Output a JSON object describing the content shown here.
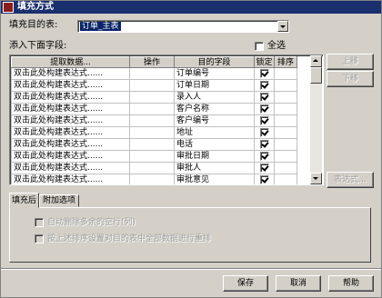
{
  "window": {
    "title": "填充方式"
  },
  "target": {
    "label": "填充目的表:",
    "value": "订单_主表"
  },
  "fields_label": "添入下面字段:",
  "select_all": {
    "label": "全选",
    "checked": false
  },
  "table": {
    "columns": [
      "提取数据...",
      "操作",
      "目的字段",
      "锁定",
      "排序"
    ],
    "rows": [
      {
        "source": "双击此处构建表达式......",
        "op": "",
        "field": "订单编号",
        "locked": true,
        "sort": ""
      },
      {
        "source": "双击此处构建表达式......",
        "op": "",
        "field": "订单日期",
        "locked": true,
        "sort": ""
      },
      {
        "source": "双击此处构建表达式......",
        "op": "",
        "field": "录入人",
        "locked": true,
        "sort": ""
      },
      {
        "source": "双击此处构建表达式......",
        "op": "",
        "field": "客户名称",
        "locked": true,
        "sort": ""
      },
      {
        "source": "双击此处构建表达式......",
        "op": "",
        "field": "客户编号",
        "locked": true,
        "sort": ""
      },
      {
        "source": "双击此处构建表达式......",
        "op": "",
        "field": "地址",
        "locked": true,
        "sort": ""
      },
      {
        "source": "双击此处构建表达式......",
        "op": "",
        "field": "电话",
        "locked": true,
        "sort": ""
      },
      {
        "source": "双击此处构建表达式......",
        "op": "",
        "field": "审批日期",
        "locked": true,
        "sort": ""
      },
      {
        "source": "双击此处构建表达式......",
        "op": "",
        "field": "审批人",
        "locked": true,
        "sort": ""
      },
      {
        "source": "双击此处构建表达式......",
        "op": "",
        "field": "审批意见",
        "locked": true,
        "sort": ""
      }
    ]
  },
  "side_buttons": {
    "up": "上移",
    "down": "下移",
    "expr": "表达式..."
  },
  "tabs": [
    {
      "label": "填充后",
      "active": true
    },
    {
      "label": "附加选项",
      "active": false
    }
  ],
  "options": [
    {
      "label": "自动删除多余的空行(列)",
      "checked": false
    },
    {
      "label": "按上述排序设置对目的表中全部数据进行重排",
      "checked": false
    }
  ],
  "footer": {
    "ok": "保存",
    "cancel": "取消",
    "help": "帮助"
  }
}
